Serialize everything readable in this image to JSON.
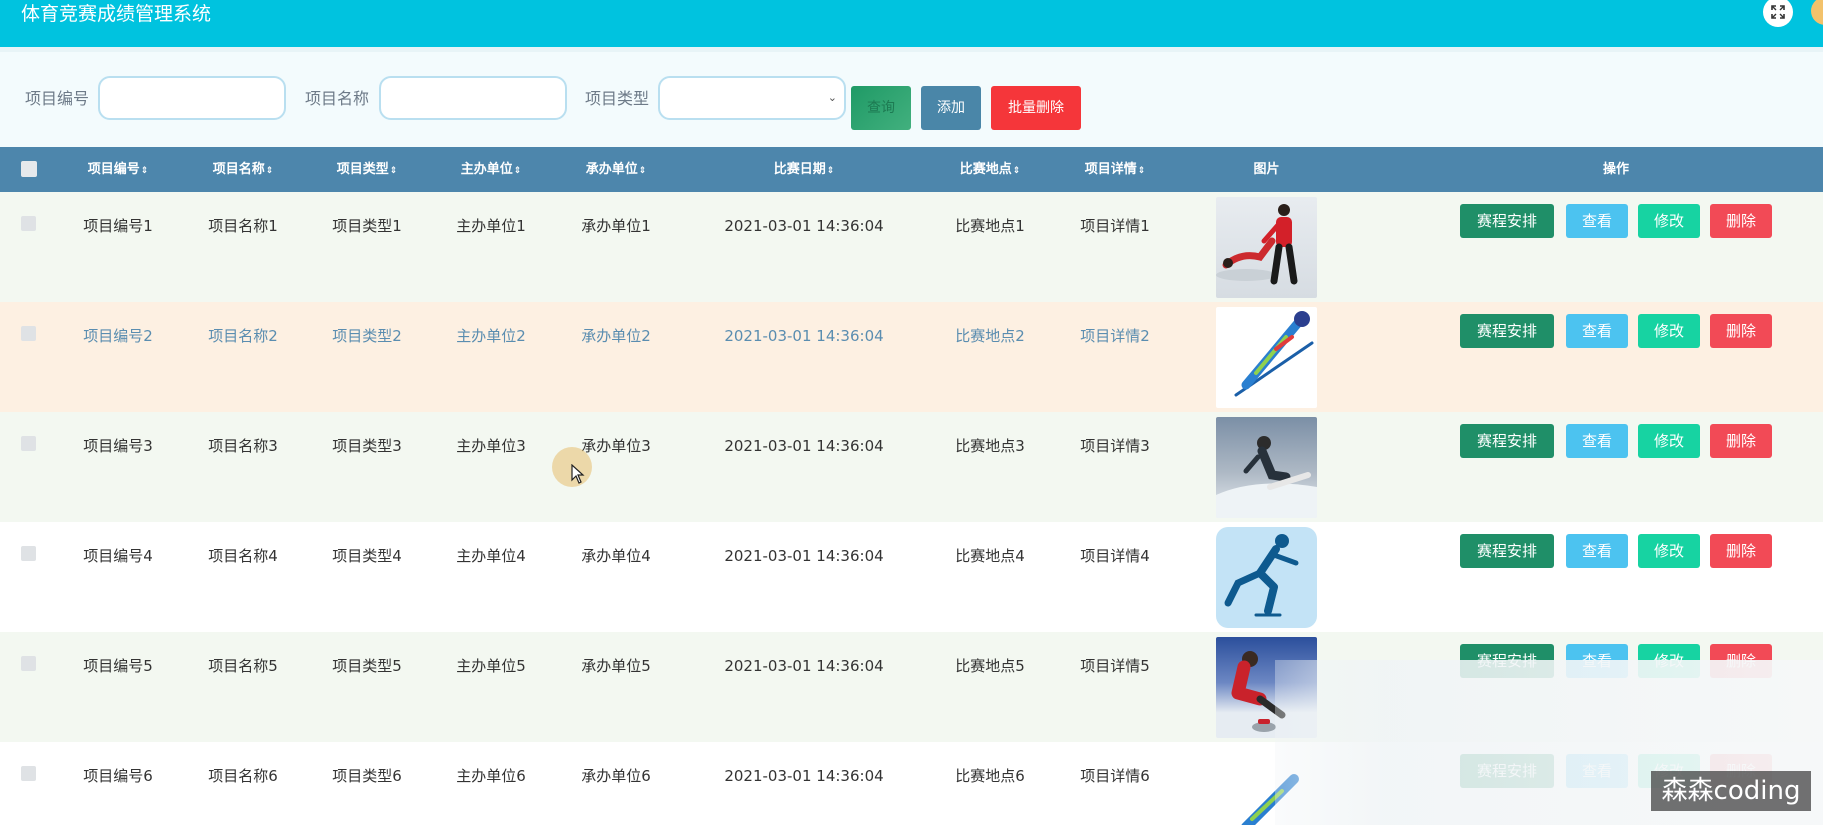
{
  "app": {
    "title": "体育竞赛成绩管理系统",
    "header_color": "#00c3df"
  },
  "search": {
    "labels": {
      "code": "项目编号",
      "name": "项目名称",
      "type": "项目类型"
    },
    "values": {
      "code": "",
      "name": "",
      "type": ""
    },
    "buttons": {
      "query": "查询",
      "add": "添加",
      "batch_delete": "批量删除"
    }
  },
  "table": {
    "columns": [
      "项目编号",
      "项目名称",
      "项目类型",
      "主办单位",
      "承办单位",
      "比赛日期",
      "比赛地点",
      "项目详情",
      "图片",
      "操作"
    ],
    "sort_icon": "⇕",
    "rows": [
      {
        "code": "项目编号1",
        "name": "项目名称1",
        "type": "项目类型1",
        "host": "主办单位1",
        "organizer": "承办单位1",
        "date": "2021-03-01 14:36:04",
        "venue": "比赛地点1",
        "detail": "项目详情1",
        "image": "figure-skating-pair"
      },
      {
        "code": "项目编号2",
        "name": "项目名称2",
        "type": "项目类型2",
        "host": "主办单位2",
        "organizer": "承办单位2",
        "date": "2021-03-01 14:36:04",
        "venue": "比赛地点2",
        "detail": "项目详情2",
        "image": "ski-jump-pictogram"
      },
      {
        "code": "项目编号3",
        "name": "项目名称3",
        "type": "项目类型3",
        "host": "主办单位3",
        "organizer": "承办单位3",
        "date": "2021-03-01 14:36:04",
        "venue": "比赛地点3",
        "detail": "项目详情3",
        "image": "snowboarder"
      },
      {
        "code": "项目编号4",
        "name": "项目名称4",
        "type": "项目类型4",
        "host": "主办单位4",
        "organizer": "承办单位4",
        "date": "2021-03-01 14:36:04",
        "venue": "比赛地点4",
        "detail": "项目详情4",
        "image": "speed-skating-pictogram"
      },
      {
        "code": "项目编号5",
        "name": "项目名称5",
        "type": "项目类型5",
        "host": "主办单位5",
        "organizer": "承办单位5",
        "date": "2021-03-01 14:36:04",
        "venue": "比赛地点5",
        "detail": "项目详情5",
        "image": "curling-player"
      },
      {
        "code": "项目编号6",
        "name": "项目名称6",
        "type": "项目类型6",
        "host": "主办单位6",
        "organizer": "承办单位6",
        "date": "2021-03-01 14:36:04",
        "venue": "比赛地点6",
        "detail": "项目详情6",
        "image": "ski-pictogram"
      }
    ],
    "actions": {
      "schedule": "赛程安排",
      "view": "查看",
      "edit": "修改",
      "delete": "删除"
    }
  },
  "watermark": "森森coding",
  "colors": {
    "header": "#00c3df",
    "table_header": "#4d86ac",
    "row_alt": "#f3f8f1",
    "row_hover": "#fdf0e2",
    "schedule_btn": "#1f8f68",
    "view_btn": "#4cc3f0",
    "edit_btn": "#17d3a2",
    "delete_btn": "#f24a56"
  }
}
